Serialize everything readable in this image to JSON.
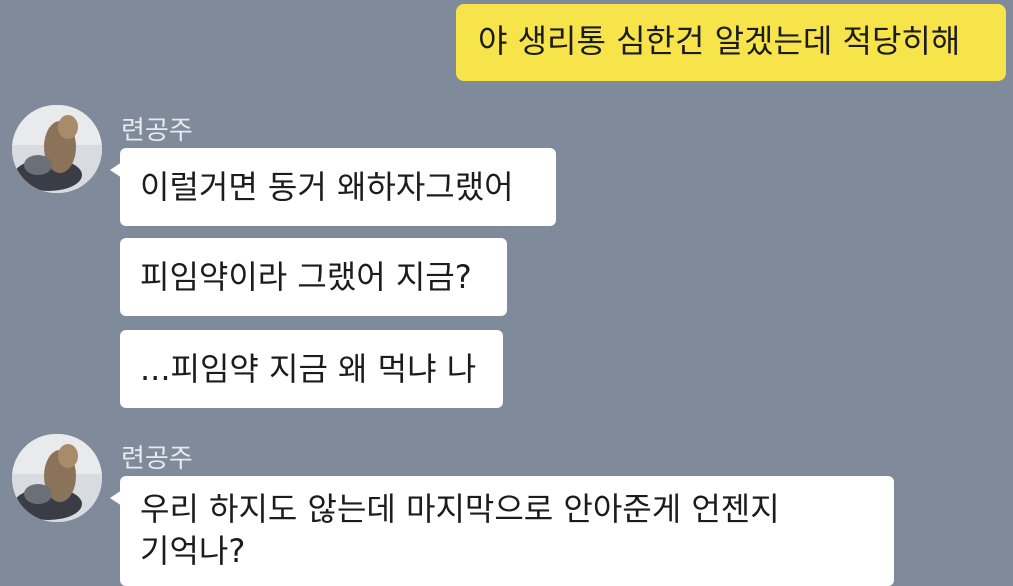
{
  "conversation": {
    "my_message": "야 생리통 심한건 알겠는데 적당히해",
    "group1": {
      "sender": "련공주",
      "messages": [
        "이럴거면 동거 왜하자그랬어",
        "피임약이라 그랬어 지금?",
        "...피임약 지금 왜 먹냐 나"
      ]
    },
    "group2": {
      "sender": "련공주",
      "message_line1": "우리 하지도 않는데 마지막으로 안아준게 언젠지",
      "message_line2": "기억나?"
    }
  },
  "colors": {
    "background": "#7f8a9a",
    "my_bubble": "#f7e34a",
    "their_bubble": "#ffffff"
  },
  "icons": {
    "avatar": "profile-photo"
  }
}
